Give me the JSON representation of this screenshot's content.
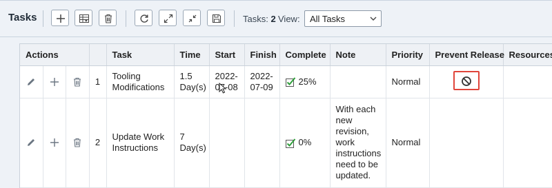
{
  "toolbar": {
    "title": "Tasks",
    "buttons": [
      {
        "name": "add-task-button",
        "icon": "plus-icon"
      },
      {
        "name": "grid-view-button",
        "icon": "grid-icon"
      },
      {
        "name": "delete-button",
        "icon": "trash-icon"
      },
      {
        "name": "refresh-button",
        "icon": "refresh-icon"
      },
      {
        "name": "expand-button",
        "icon": "expand-icon"
      },
      {
        "name": "collapse-button",
        "icon": "collapse-icon"
      },
      {
        "name": "save-button",
        "icon": "save-icon"
      }
    ],
    "tasks_label": "Tasks:",
    "tasks_count": "2",
    "view_label": "View:",
    "view_value": "All Tasks"
  },
  "table": {
    "actions_header": "Actions",
    "columns": [
      "Task",
      "Time",
      "Start",
      "Finish",
      "Complete",
      "Note",
      "Priority",
      "Prevent Release",
      "Resources"
    ],
    "rows": [
      {
        "num": "1",
        "task": "Tooling Modifications",
        "time": "1.5 Day(s)",
        "start": "2022-07-08",
        "finish": "2022-07-09",
        "complete": "25%",
        "note": "",
        "priority": "Normal",
        "prevent_release": true,
        "resources": ""
      },
      {
        "num": "2",
        "task": "Update Work Instructions",
        "time": "7 Day(s)",
        "start": "",
        "finish": "",
        "complete": "0%",
        "note": "With each new revision, work instructions need to be updated.",
        "priority": "Normal",
        "prevent_release": false,
        "resources": ""
      }
    ]
  },
  "colors": {
    "accent_red": "#e0443a",
    "check_green": "#2e9e3a"
  }
}
